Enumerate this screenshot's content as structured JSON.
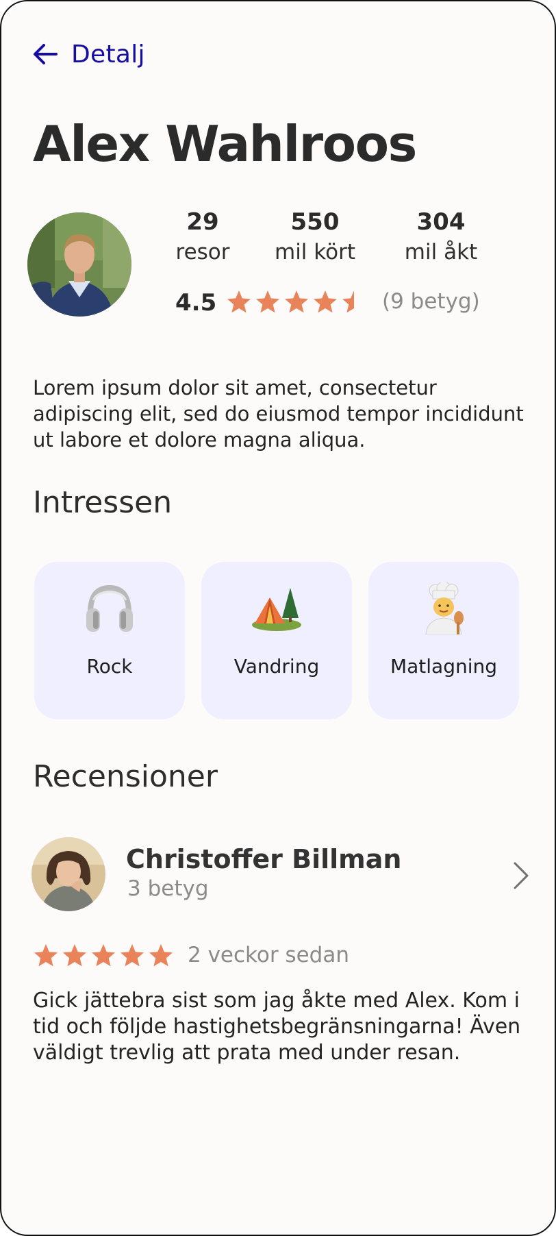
{
  "nav": {
    "back_label": "Detalj"
  },
  "profile": {
    "name": "Alex Wahlroos",
    "stats": [
      {
        "value": "29",
        "label": "resor"
      },
      {
        "value": "550",
        "label": "mil kört"
      },
      {
        "value": "304",
        "label": "mil åkt"
      }
    ],
    "rating": {
      "value": "4.5",
      "stars": 4.5,
      "count": "(9 betyg)"
    },
    "bio": "Lorem ipsum dolor sit amet, consectetur adipiscing elit, sed do eiusmod tempor incididunt ut labore et dolore magna aliqua."
  },
  "interests": {
    "title": "Intressen",
    "items": [
      {
        "label": "Rock",
        "icon": "headphones-icon"
      },
      {
        "label": "Vandring",
        "icon": "camping-tent-icon"
      },
      {
        "label": "Matlagning",
        "icon": "chef-icon"
      }
    ]
  },
  "reviews": {
    "title": "Recensioner",
    "items": [
      {
        "reviewer": "Christoffer Billman",
        "reviewer_count": "3 betyg",
        "stars": 5,
        "time": "2 veckor sedan",
        "text": "Gick jättebra sist som jag åkte med Alex. Kom i tid och följde hastighetsbegränsningarna! Även väldigt trevlig att prata med under resan."
      }
    ]
  },
  "colors": {
    "accent": "#150ea0",
    "star": "#e8835a",
    "card": "#f0efff",
    "muted": "#8a8a8a"
  }
}
